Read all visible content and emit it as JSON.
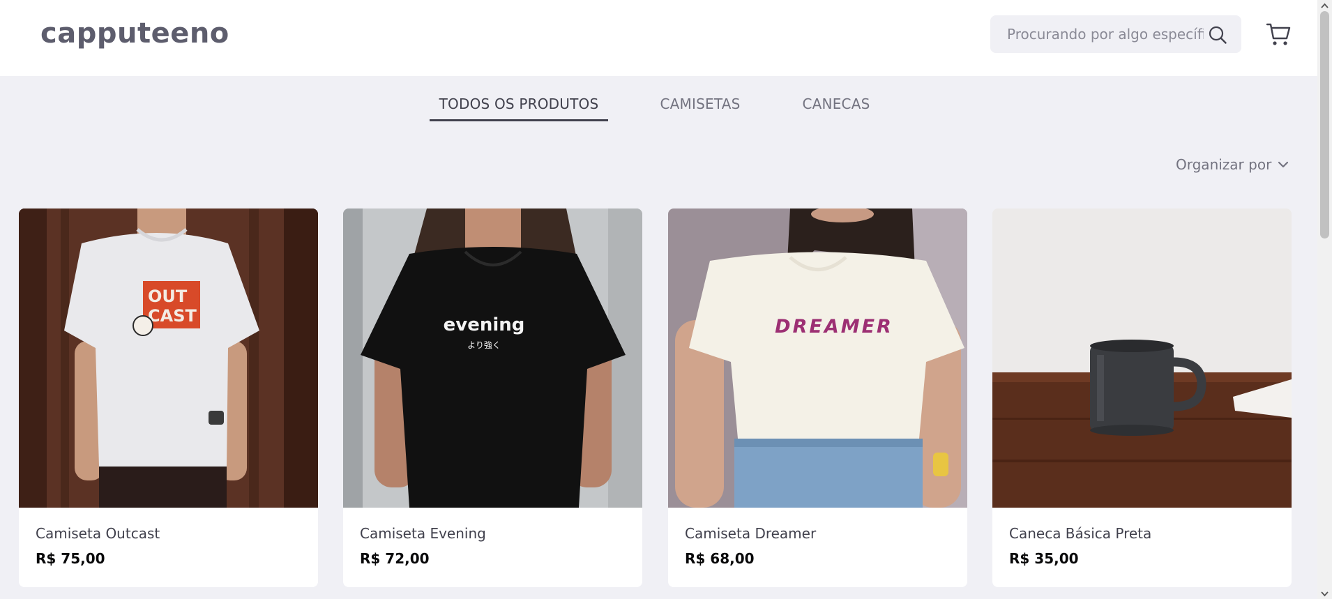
{
  "header": {
    "logo": "capputeeno",
    "search": {
      "placeholder": "Procurando por algo específico?",
      "value": ""
    },
    "icons": {
      "search": "search-icon",
      "cart": "cart-icon"
    }
  },
  "tabs": [
    {
      "label": "TODOS OS PRODUTOS",
      "active": true
    },
    {
      "label": "CAMISETAS",
      "active": false
    },
    {
      "label": "CANECAS",
      "active": false
    }
  ],
  "sort": {
    "label": "Organizar por",
    "icon": "chevron-down-icon"
  },
  "products": [
    {
      "name": "Camiseta Outcast",
      "price": "R$ 75,00",
      "image_text": [
        "OUT",
        "CAST"
      ]
    },
    {
      "name": "Camiseta Evening",
      "price": "R$ 72,00",
      "image_text": [
        "evening",
        "より強く"
      ]
    },
    {
      "name": "Camiseta Dreamer",
      "price": "R$ 68,00",
      "image_text": [
        "DREAMER"
      ]
    },
    {
      "name": "Caneca Básica Preta",
      "price": "R$ 35,00"
    }
  ],
  "colors": {
    "page_bg": "#f0f0f5",
    "header_bg": "#ffffff",
    "text_primary": "#41414d",
    "text_secondary": "#737380",
    "price": "#09090a",
    "logo": "#5d5d6d"
  }
}
